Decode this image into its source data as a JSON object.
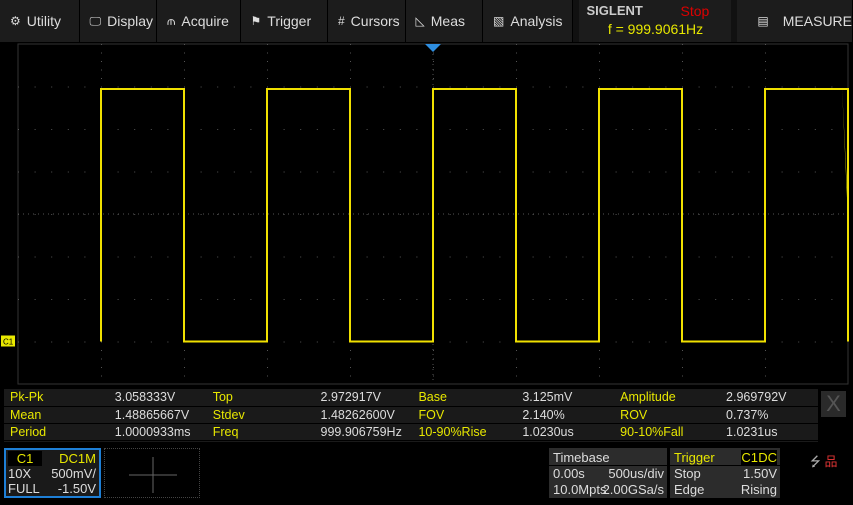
{
  "menu": [
    {
      "label": "Utility",
      "icon": "gear-icon",
      "glyph": "⚙"
    },
    {
      "label": "Display",
      "icon": "monitor-icon",
      "glyph": "🖵"
    },
    {
      "label": "Acquire",
      "icon": "acquire-icon",
      "glyph": "⫙"
    },
    {
      "label": "Trigger",
      "icon": "flag-icon",
      "glyph": "⚑"
    },
    {
      "label": "Cursors",
      "icon": "cursors-icon",
      "glyph": "#"
    },
    {
      "label": "Meas",
      "icon": "ruler-icon",
      "glyph": "◺"
    },
    {
      "label": "Analysis",
      "icon": "analysis-icon",
      "glyph": "▧"
    }
  ],
  "brand": {
    "logo": "SIGLENT",
    "status": "Stop",
    "freq": "f = 999.9061Hz"
  },
  "measure_menu": {
    "label": "MEASURE",
    "icon": "battery-icon",
    "glyph": "▤"
  },
  "channel_marker": "C1",
  "waveform": {
    "color": "#f0e000",
    "high_v": 2.97,
    "low_v": 0.0,
    "period_ms": 1.0,
    "rising_edge_at_s": 0.0
  },
  "measurements": [
    [
      {
        "l": "Pk-Pk",
        "v": "3.058333V"
      },
      {
        "l": "Top",
        "v": "2.972917V"
      },
      {
        "l": "Base",
        "v": "3.125mV"
      },
      {
        "l": "Amplitude",
        "v": "2.969792V"
      }
    ],
    [
      {
        "l": "Mean",
        "v": "1.48865667V"
      },
      {
        "l": "Stdev",
        "v": "1.48262600V"
      },
      {
        "l": "FOV",
        "v": "2.140%"
      },
      {
        "l": "ROV",
        "v": "0.737%"
      }
    ],
    [
      {
        "l": "Period",
        "v": "1.0000933ms"
      },
      {
        "l": "Freq",
        "v": "999.906759Hz"
      },
      {
        "l": "10-90%Rise",
        "v": "1.0230us"
      },
      {
        "l": "90-10%Fall",
        "v": "1.0231us"
      }
    ]
  ],
  "close_label": "X",
  "channel": {
    "name": "C1",
    "coupling": "DC1M",
    "probe": "10X",
    "scale": "500mV/",
    "bw": "FULL",
    "offset": "-1.50V"
  },
  "timebase": {
    "title": "Timebase",
    "delay": "0.00s",
    "scale": "500us/div",
    "mem": "10.0Mpts",
    "rate": "2.00GSa/s"
  },
  "trigger": {
    "title": "Trigger",
    "source": "C1",
    "coupling": "DC",
    "state": "Stop",
    "level": "1.50V",
    "type": "Edge",
    "slope": "Rising"
  }
}
